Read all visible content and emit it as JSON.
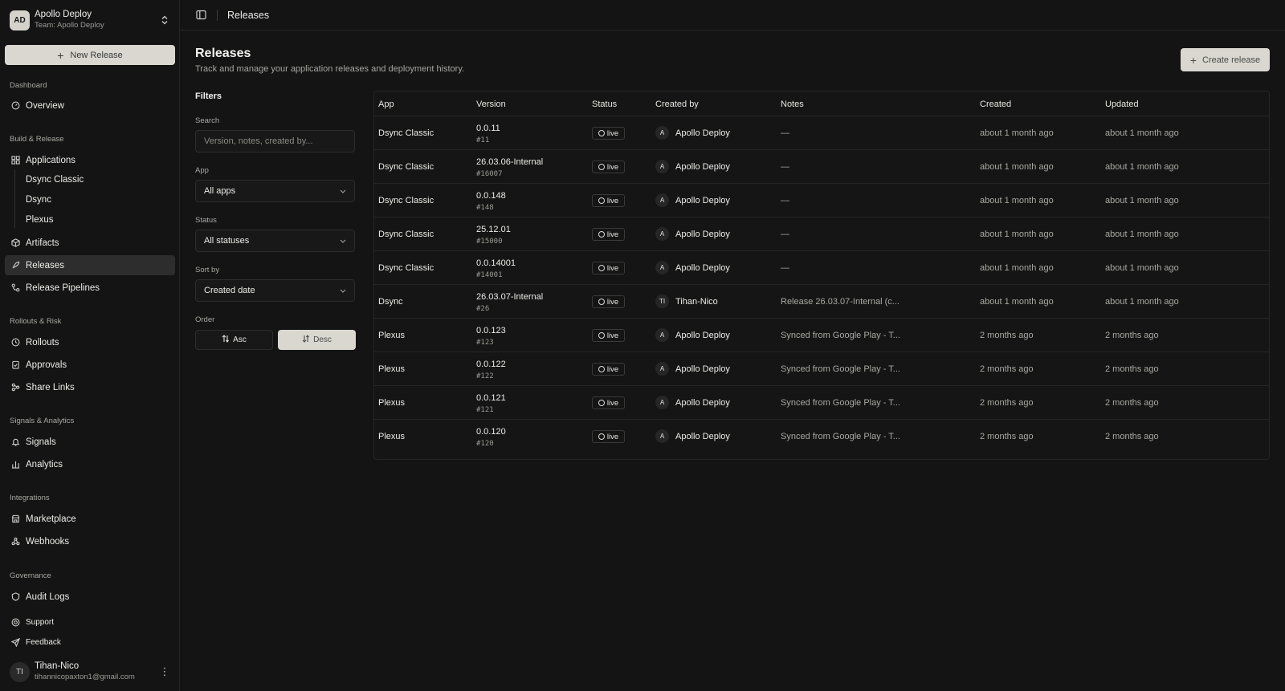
{
  "team": {
    "avatar": "AD",
    "name": "Apollo Deploy",
    "subtitle": "Team: Apollo Deploy"
  },
  "sidebar": {
    "new_release": "New Release",
    "groups": {
      "dashboard": "Dashboard",
      "build": "Build & Release",
      "rollouts": "Rollouts & Risk",
      "signals": "Signals & Analytics",
      "integrations": "Integrations",
      "governance": "Governance"
    },
    "items": {
      "overview": "Overview",
      "applications": "Applications",
      "app_dsync_classic": "Dsync Classic",
      "app_dsync": "Dsync",
      "app_plexus": "Plexus",
      "artifacts": "Artifacts",
      "releases": "Releases",
      "pipelines": "Release Pipelines",
      "rollouts": "Rollouts",
      "approvals": "Approvals",
      "share_links": "Share Links",
      "signals": "Signals",
      "analytics": "Analytics",
      "marketplace": "Marketplace",
      "webhooks": "Webhooks",
      "audit_logs": "Audit Logs",
      "support": "Support",
      "feedback": "Feedback"
    },
    "active": "releases"
  },
  "user": {
    "avatar": "TI",
    "name": "Tihan-Nico",
    "email": "tihannicopaxton1@gmail.com"
  },
  "topbar": {
    "title": "Releases"
  },
  "header": {
    "title": "Releases",
    "description": "Track and manage your application releases and deployment history.",
    "create_label": "Create release"
  },
  "filters": {
    "title": "Filters",
    "search_label": "Search",
    "search_placeholder": "Version, notes, created by...",
    "app_label": "App",
    "app_value": "All apps",
    "status_label": "Status",
    "status_value": "All statuses",
    "sort_label": "Sort by",
    "sort_value": "Created date",
    "order_label": "Order",
    "asc_label": "Asc",
    "desc_label": "Desc",
    "order_selected": "desc"
  },
  "table": {
    "columns": [
      "App",
      "Version",
      "Status",
      "Created by",
      "Notes",
      "Created",
      "Updated"
    ],
    "rows": [
      {
        "app": "Dsync Classic",
        "version": "0.0.11",
        "build": "#11",
        "status": "live",
        "creator": "Apollo Deploy",
        "creator_av": "A",
        "notes": "—",
        "created": "about 1 month ago",
        "updated": "about 1 month ago"
      },
      {
        "app": "Dsync Classic",
        "version": "26.03.06-Internal",
        "build": "#16007",
        "status": "live",
        "creator": "Apollo Deploy",
        "creator_av": "A",
        "notes": "—",
        "created": "about 1 month ago",
        "updated": "about 1 month ago"
      },
      {
        "app": "Dsync Classic",
        "version": "0.0.148",
        "build": "#148",
        "status": "live",
        "creator": "Apollo Deploy",
        "creator_av": "A",
        "notes": "—",
        "created": "about 1 month ago",
        "updated": "about 1 month ago"
      },
      {
        "app": "Dsync Classic",
        "version": "25.12.01",
        "build": "#15000",
        "status": "live",
        "creator": "Apollo Deploy",
        "creator_av": "A",
        "notes": "—",
        "created": "about 1 month ago",
        "updated": "about 1 month ago"
      },
      {
        "app": "Dsync Classic",
        "version": "0.0.14001",
        "build": "#14001",
        "status": "live",
        "creator": "Apollo Deploy",
        "creator_av": "A",
        "notes": "—",
        "created": "about 1 month ago",
        "updated": "about 1 month ago"
      },
      {
        "app": "Dsync",
        "version": "26.03.07-Internal",
        "build": "#26",
        "status": "live",
        "creator": "Tihan-Nico",
        "creator_av": "TI",
        "notes": "Release 26.03.07-Internal (c...",
        "created": "about 1 month ago",
        "updated": "about 1 month ago"
      },
      {
        "app": "Plexus",
        "version": "0.0.123",
        "build": "#123",
        "status": "live",
        "creator": "Apollo Deploy",
        "creator_av": "A",
        "notes": "Synced from Google Play - T...",
        "created": "2 months ago",
        "updated": "2 months ago"
      },
      {
        "app": "Plexus",
        "version": "0.0.122",
        "build": "#122",
        "status": "live",
        "creator": "Apollo Deploy",
        "creator_av": "A",
        "notes": "Synced from Google Play - T...",
        "created": "2 months ago",
        "updated": "2 months ago"
      },
      {
        "app": "Plexus",
        "version": "0.0.121",
        "build": "#121",
        "status": "live",
        "creator": "Apollo Deploy",
        "creator_av": "A",
        "notes": "Synced from Google Play - T...",
        "created": "2 months ago",
        "updated": "2 months ago"
      },
      {
        "app": "Plexus",
        "version": "0.0.120",
        "build": "#120",
        "status": "live",
        "creator": "Apollo Deploy",
        "creator_av": "A",
        "notes": "Synced from Google Play - T...",
        "created": "2 months ago",
        "updated": "2 months ago"
      }
    ]
  }
}
